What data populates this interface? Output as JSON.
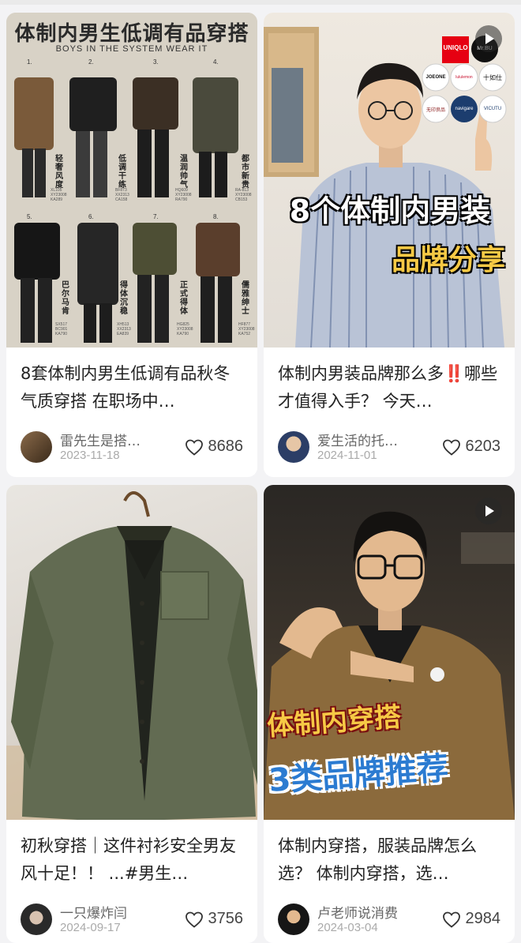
{
  "colors": {
    "background": "#f3f3f5",
    "card": "#ffffff",
    "heart": "#333333"
  },
  "feed": [
    {
      "title": "8套体制内男生低调有品秋冬气质穿搭 在职场中…",
      "author": "雷先生是搭…",
      "date": "2023-11-18",
      "likes": "8686",
      "video": false,
      "cover": {
        "heading": "体制内男生低调有品穿搭",
        "subheading": "BOYS IN THE SYSTEM WEAR IT",
        "outfits": [
          {
            "num": "1.",
            "label": "轻奢风度",
            "code": "XL105\nXY23008\nKA289"
          },
          {
            "num": "2.",
            "label": "低调干练",
            "code": "BF873\nXX2313\nCA158"
          },
          {
            "num": "3.",
            "label": "温润帅气",
            "code": "HQ609\nXY23008\nRA790"
          },
          {
            "num": "4.",
            "label": "都市新贵",
            "code": "RA-813\nXY23008\nCB153"
          },
          {
            "num": "5.",
            "label": "巴尔马肯",
            "code": "SX517\nBC901\nKA790"
          },
          {
            "num": "6.",
            "label": "得体沉稳",
            "code": "XH513\nXX2313\nEA839"
          },
          {
            "num": "7.",
            "label": "正式得体",
            "code": "HG825\nXY23008\nKA790"
          },
          {
            "num": "8.",
            "label": "儒雅绅士",
            "code": "HF877\nXY23008\nKA752"
          }
        ]
      }
    },
    {
      "title": "体制内男装品牌那么多‼️哪些才值得入手？ 今天…",
      "author": "爱生活的托…",
      "date": "2024-11-01",
      "likes": "6203",
      "video": true,
      "cover": {
        "line1": "8个体制内男装",
        "line2": "品牌分享",
        "brands": [
          "UNIQLO",
          "Mr.BU",
          "JOEONE",
          "lululemon",
          "十如仕",
          "无印良品",
          "navigare",
          "VICUTU"
        ]
      }
    },
    {
      "title": "初秋穿搭｜这件衬衫安全男友风十足！！ ...#男生…",
      "author": "一只爆炸闫",
      "date": "2024-09-17",
      "likes": "3756",
      "video": false,
      "cover": {}
    },
    {
      "title": "体制内穿搭，服装品牌怎么选？ 体制内穿搭，选…",
      "author": "卢老师说消费",
      "date": "2024-03-04",
      "likes": "2984",
      "video": true,
      "cover": {
        "line1": "体制内穿搭",
        "line2": "3类品牌推荐"
      }
    }
  ]
}
